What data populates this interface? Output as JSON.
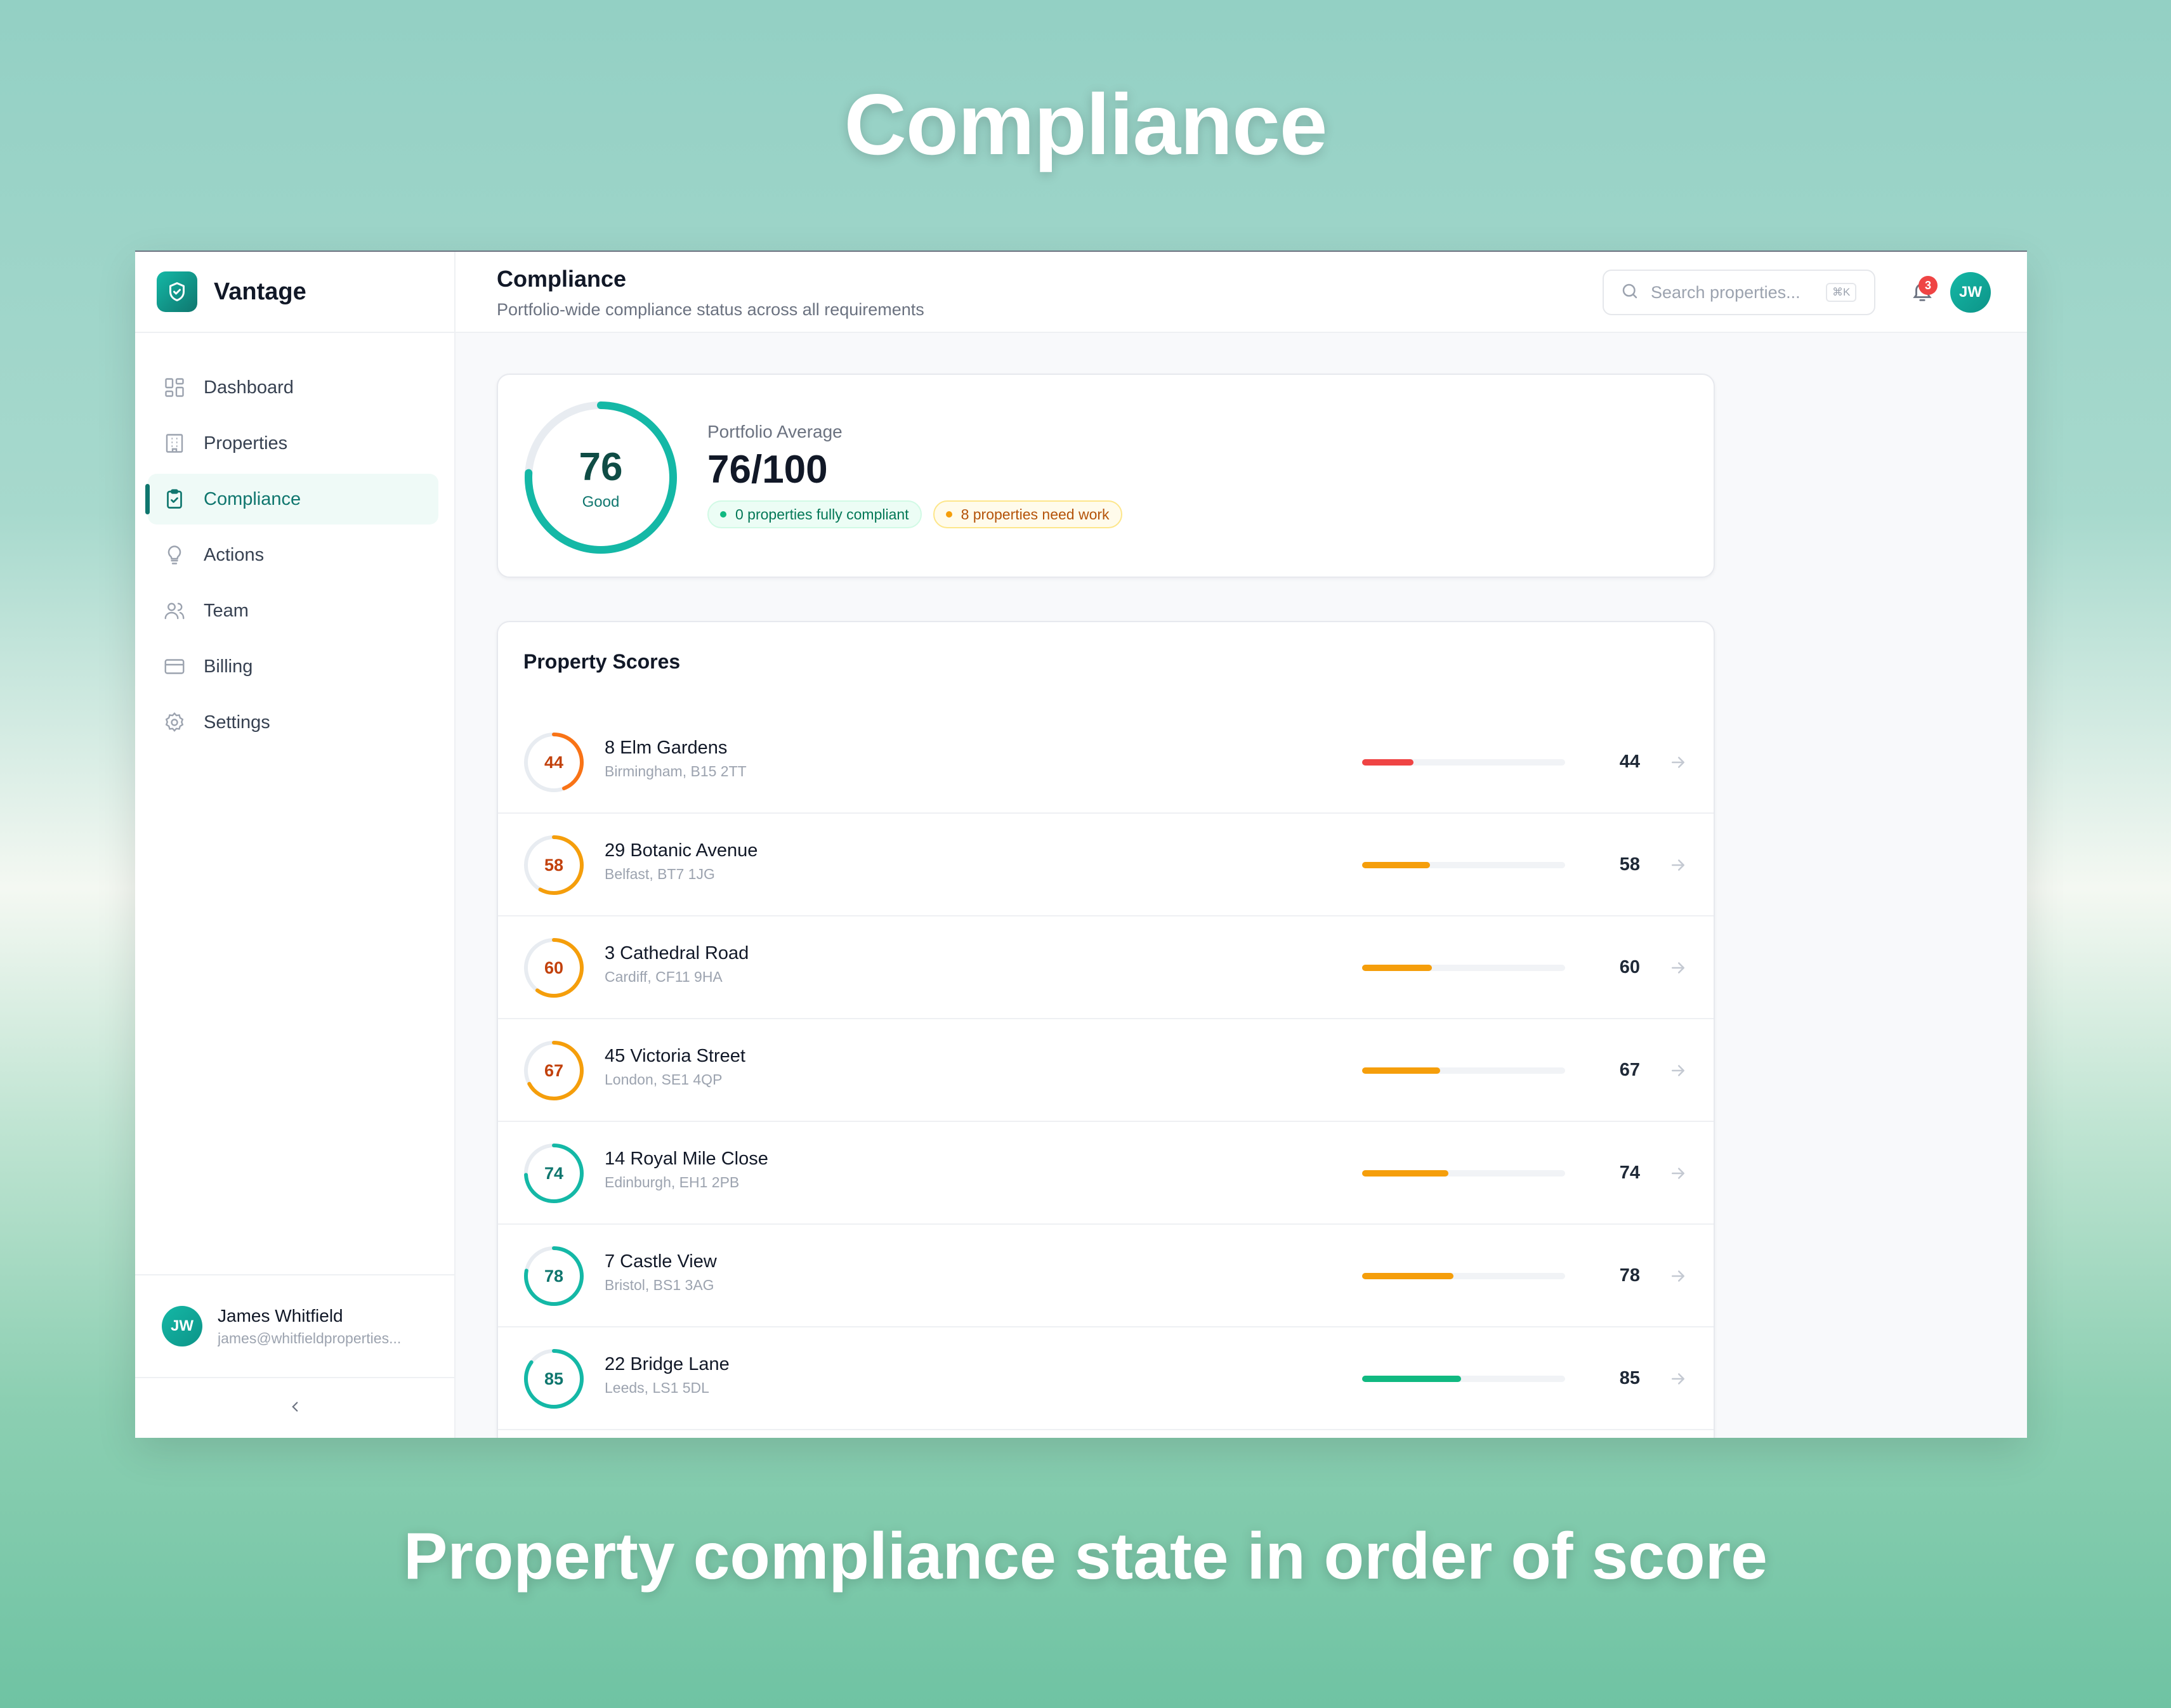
{
  "hero": {
    "title": "Compliance",
    "caption": "Property compliance state in order of score"
  },
  "brand": {
    "name": "Vantage",
    "icon": "shield-check-icon"
  },
  "nav": [
    {
      "label": "Dashboard",
      "icon": "grid-icon",
      "active": false
    },
    {
      "label": "Properties",
      "icon": "building-icon",
      "active": false
    },
    {
      "label": "Compliance",
      "icon": "clipboard-check-icon",
      "active": true
    },
    {
      "label": "Actions",
      "icon": "lightbulb-icon",
      "active": false
    },
    {
      "label": "Team",
      "icon": "users-icon",
      "active": false
    },
    {
      "label": "Billing",
      "icon": "credit-card-icon",
      "active": false
    },
    {
      "label": "Settings",
      "icon": "gear-icon",
      "active": false
    }
  ],
  "user": {
    "initials": "JW",
    "name": "James Whitfield",
    "email": "james@whitfieldproperties..."
  },
  "header": {
    "title": "Compliance",
    "subtitle": "Portfolio-wide compliance status across all requirements",
    "search_placeholder": "Search properties...",
    "search_shortcut": "⌘K",
    "notification_count": "3",
    "avatar_initials": "JW"
  },
  "summary": {
    "score": "76",
    "score_value": 76,
    "score_label": "Good",
    "avg_label": "Portfolio Average",
    "avg_value": "76/100",
    "compliant_pill": "0 properties fully compliant",
    "work_pill": "8 properties need work"
  },
  "scores": {
    "title": "Property Scores",
    "rows": [
      {
        "name": "8 Elm Gardens",
        "address": "Birmingham, B15 2TT",
        "score": 44,
        "score_text": "44"
      },
      {
        "name": "29 Botanic Avenue",
        "address": "Belfast, BT7 1JG",
        "score": 58,
        "score_text": "58"
      },
      {
        "name": "3 Cathedral Road",
        "address": "Cardiff, CF11 9HA",
        "score": 60,
        "score_text": "60"
      },
      {
        "name": "45 Victoria Street",
        "address": "London, SE1 4QP",
        "score": 67,
        "score_text": "67"
      },
      {
        "name": "14 Royal Mile Close",
        "address": "Edinburgh, EH1 2PB",
        "score": 74,
        "score_text": "74"
      },
      {
        "name": "7 Castle View",
        "address": "Bristol, BS1 3AG",
        "score": 78,
        "score_text": "78"
      },
      {
        "name": "22 Bridge Lane",
        "address": "Leeds, LS1 5DL",
        "score": 85,
        "score_text": "85"
      }
    ]
  },
  "colors": {
    "accent": "#0f766e",
    "ring_teal": "#14b8a6",
    "ring_orange": "#f97316",
    "ring_amber": "#f59e0b",
    "bar_red": "#ef4444",
    "bar_amber": "#f59e0b",
    "bar_green": "#10b981"
  }
}
